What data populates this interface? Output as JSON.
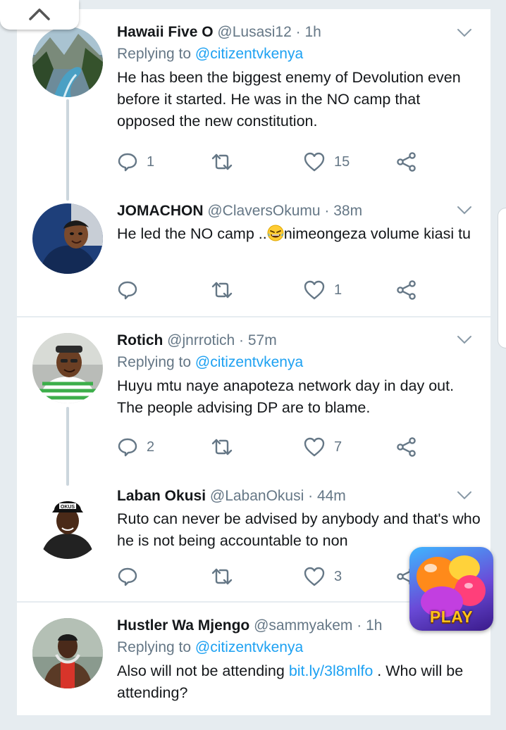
{
  "tweets": [
    {
      "name": "Hawaii Five O",
      "handle": "@Lusasi12",
      "sep": " · ",
      "time": "1h",
      "replying_prefix": "Replying to ",
      "replying_to": "@citizentvkenya",
      "text": "He has been the biggest enemy of Devolution even before it started. He was in the NO camp that opposed the new constitution.",
      "replies": "1",
      "retweets": "",
      "likes": "15"
    },
    {
      "name": "JOMACHON",
      "handle": "@ClaversOkumu",
      "sep": " · ",
      "time": "38m",
      "text_before": "He led the NO camp ..",
      "text_after": "nimeongeza volume kiasi tu",
      "replies": "",
      "retweets": "",
      "likes": "1"
    },
    {
      "name": "Rotich",
      "handle": "@jnrrotich",
      "sep": " · ",
      "time": "57m",
      "replying_prefix": "Replying to ",
      "replying_to": "@citizentvkenya",
      "text": "Huyu mtu naye anapoteza network day in day out. The people advising DP are to blame.",
      "replies": "2",
      "retweets": "",
      "likes": "7"
    },
    {
      "name": "Laban Okusi",
      "handle": "@LabanOkusi",
      "sep": " · ",
      "time": "44m",
      "text": "Ruto can never be advised by anybody and that's who he is not being accountable to non",
      "replies": "",
      "retweets": "",
      "likes": "3",
      "cap_text": "OKUS"
    },
    {
      "name": "Hustler Wa Mjengo",
      "handle": "@sammyakem",
      "sep": " · ",
      "time": "1h",
      "replying_prefix": "Replying to ",
      "replying_to": "@citizentvkenya",
      "text_before": "Also will not be attending ",
      "link": "bit.ly/3l8mlfo",
      "text_after": " . Who will be attending?"
    }
  ],
  "ad": {
    "label": "PLAY"
  },
  "icons": {
    "reply": "reply-icon",
    "retweet": "retweet-icon",
    "like": "heart-icon",
    "share": "share-icon",
    "caret": "chevron-down-icon",
    "scroll": "chevron-up-icon"
  },
  "colors": {
    "accent": "#1da1f2",
    "secondary_text": "#657786",
    "background": "#e6ecf0",
    "thread_line": "#ccd6dd"
  }
}
